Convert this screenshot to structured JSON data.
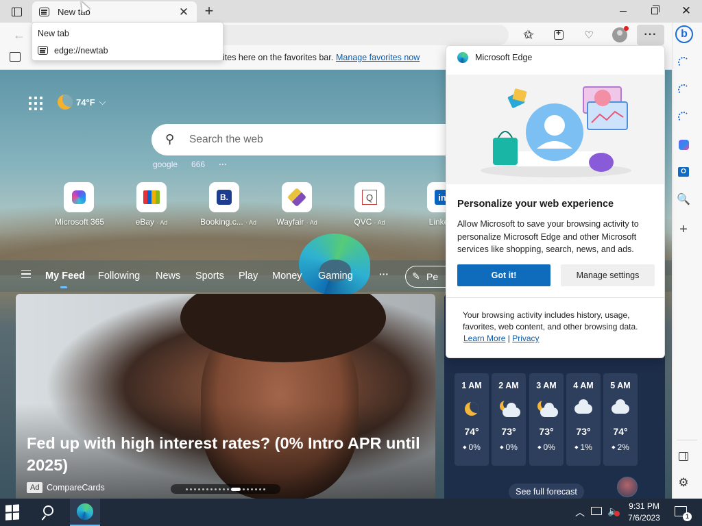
{
  "browser": {
    "tab": {
      "title": "New tab",
      "close_glyph": "✕"
    },
    "new_tab_glyph": "+",
    "window_controls": {
      "close_glyph": "✕"
    },
    "tooltip": {
      "title": "New tab",
      "url": "edge://newtab"
    },
    "toolbar": {
      "more_glyph": "···",
      "favorite_glyph": "☆",
      "favorites_glyph": "✩",
      "back_glyph": "←",
      "perf_glyph": "♡"
    },
    "favorites_bar": {
      "text": "ites here on the favorites bar.",
      "link": "Manage favorites now"
    }
  },
  "sidebar": {
    "bing_label": "b",
    "outlook_label": "O",
    "search_glyph": "🔍",
    "add_glyph": "+",
    "settings_glyph": "⚙"
  },
  "newtab": {
    "weather": {
      "temp": "74°F",
      "chevron": "⌵"
    },
    "search": {
      "placeholder": "Search the web",
      "glyph": "⚲"
    },
    "trending": [
      "google",
      "666",
      "···"
    ],
    "quick_links": [
      {
        "label": "Microsoft 365",
        "ad": ""
      },
      {
        "label": "eBay",
        "ad": "· Ad"
      },
      {
        "label": "Booking.c...",
        "ad": "· Ad",
        "glyph": "B."
      },
      {
        "label": "Wayfair",
        "ad": "· Ad"
      },
      {
        "label": "QVC",
        "ad": "· Ad",
        "glyph": "Q"
      },
      {
        "label": "Linke...",
        "ad": "",
        "glyph": "in"
      }
    ],
    "feed_tabs": [
      "My Feed",
      "Following",
      "News",
      "Sports",
      "Play",
      "Money",
      "Gaming"
    ],
    "feed_more": "···",
    "personalize_label": "Pe",
    "hero": {
      "title": "Fed up with high interest rates? (0% Intro APR until 2025)",
      "ad_badge": "Ad",
      "source": "CompareCards"
    },
    "hourly": [
      {
        "time": "1 AM",
        "icon": "moon-icon",
        "temp": "74°",
        "precip": "0%"
      },
      {
        "time": "2 AM",
        "icon": "cloud-moon-icon",
        "temp": "73°",
        "precip": "0%"
      },
      {
        "time": "3 AM",
        "icon": "cloud-moon-icon",
        "temp": "73°",
        "precip": "0%"
      },
      {
        "time": "4 AM",
        "icon": "cloud-icon",
        "temp": "73°",
        "precip": "1%"
      },
      {
        "time": "5 AM",
        "icon": "cloud-icon",
        "temp": "74°",
        "precip": "2%"
      }
    ],
    "forecast_button": "See full forecast"
  },
  "flyout": {
    "app_name": "Microsoft Edge",
    "heading": "Personalize your web experience",
    "body": "Allow Microsoft to save your browsing activity to personalize Microsoft Edge and other Microsoft services like shopping, search, news, and ads.",
    "primary_button": "Got it!",
    "secondary_button": "Manage settings",
    "footer": "Your browsing activity includes history, usage, favorites, web content, and other browsing data.",
    "learn_more": "Learn More",
    "separator": "|",
    "privacy": "Privacy"
  },
  "taskbar": {
    "clock_time": "9:31 PM",
    "clock_date": "7/6/2023",
    "tray_chevron": "︿",
    "notification_count": "1"
  },
  "colors": {
    "accent": "#0f6cbd",
    "taskbar": "#1f2a3a",
    "weather_card": "#1d2e4b"
  }
}
